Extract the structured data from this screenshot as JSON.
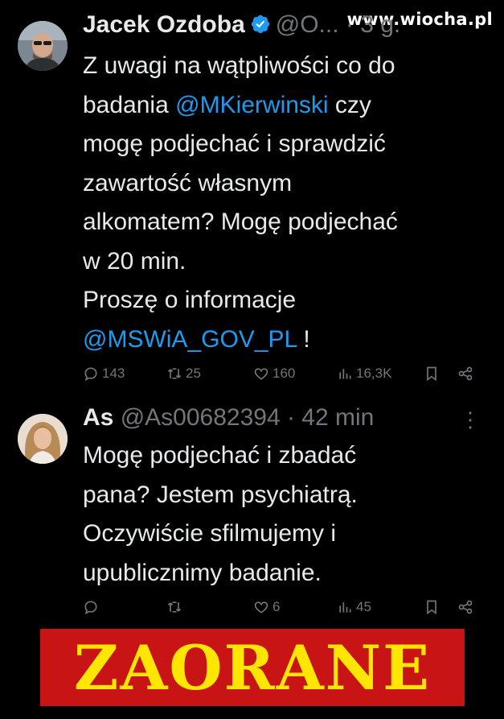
{
  "watermark": "www.wiocha.pl",
  "tweets": [
    {
      "name": "Jacek Ozdoba",
      "handle": "@O... · 3 g.",
      "verified": true,
      "lines": {
        "l1": "Z uwagi na wątpliwości co do",
        "l2a": "badania ",
        "l2m": "@MKierwinski",
        "l2b": " czy",
        "l3": "mogę podjechać i sprawdzić",
        "l4": "zawartość własnym",
        "l5": "alkomatem? Mogę podjechać",
        "l6": "w 20 min.",
        "l7": "Proszę o informacje",
        "l8m": "@MSWiA_GOV_PL",
        "l8b": " !"
      },
      "stats": {
        "replies": "143",
        "retweets": "25",
        "likes": "160",
        "views": "16,3K"
      }
    },
    {
      "name": "As",
      "handle": "@As00682394 · 42 min",
      "lines": {
        "l1": "Mogę podjechać i zbadać",
        "l2": "pana? Jestem psychiatrą.",
        "l3": "Oczywiście sfilmujemy i",
        "l4": "upublicznimy badanie."
      },
      "stats": {
        "replies": "",
        "retweets": "",
        "likes": "6",
        "views": "45"
      },
      "more": "⋮"
    }
  ],
  "banner": {
    "text": "ZAORANE",
    "bg": "#c81414",
    "fg": "#ffe600"
  },
  "colors": {
    "link": "#1d9bf0",
    "muted": "#71767b",
    "text": "#e7e9ea",
    "verified": "#1d9bf0"
  }
}
